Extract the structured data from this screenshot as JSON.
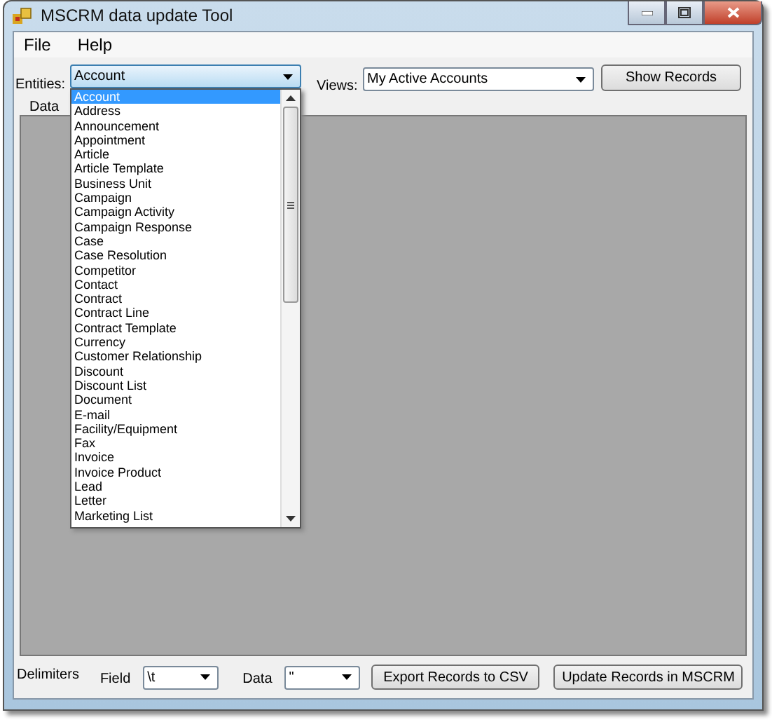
{
  "window": {
    "title": "MSCRM data update Tool"
  },
  "menu": [
    "File",
    "Help"
  ],
  "entities": {
    "label": "Entities:",
    "value": "Account",
    "expanded": true,
    "options": [
      {
        "label": "Account",
        "selected": true
      },
      {
        "label": "Address",
        "selected": false
      },
      {
        "label": "Announcement",
        "selected": false
      },
      {
        "label": "Appointment",
        "selected": false
      },
      {
        "label": "Article",
        "selected": false
      },
      {
        "label": "Article Template",
        "selected": false
      },
      {
        "label": "Business Unit",
        "selected": false
      },
      {
        "label": "Campaign",
        "selected": false
      },
      {
        "label": "Campaign Activity",
        "selected": false
      },
      {
        "label": "Campaign Response",
        "selected": false
      },
      {
        "label": "Case",
        "selected": false
      },
      {
        "label": "Case Resolution",
        "selected": false
      },
      {
        "label": "Competitor",
        "selected": false
      },
      {
        "label": "Contact",
        "selected": false
      },
      {
        "label": "Contract",
        "selected": false
      },
      {
        "label": "Contract Line",
        "selected": false
      },
      {
        "label": "Contract Template",
        "selected": false
      },
      {
        "label": "Currency",
        "selected": false
      },
      {
        "label": "Customer Relationship",
        "selected": false
      },
      {
        "label": "Discount",
        "selected": false
      },
      {
        "label": "Discount List",
        "selected": false
      },
      {
        "label": "Document",
        "selected": false
      },
      {
        "label": "E-mail",
        "selected": false
      },
      {
        "label": "Facility/Equipment",
        "selected": false
      },
      {
        "label": "Fax",
        "selected": false
      },
      {
        "label": "Invoice",
        "selected": false
      },
      {
        "label": "Invoice Product",
        "selected": false
      },
      {
        "label": "Lead",
        "selected": false
      },
      {
        "label": "Letter",
        "selected": false
      },
      {
        "label": "Marketing List",
        "selected": false
      }
    ]
  },
  "views": {
    "label": "Views:",
    "value": "My Active Accounts"
  },
  "show_button": "Show Records",
  "data_group": {
    "title": "Data"
  },
  "delimiters": {
    "label": "Delimiters",
    "field_label": "Field",
    "field_value": "\\t",
    "data_label": "Data",
    "data_value": "\""
  },
  "buttons": [
    "Export Records to CSV",
    "Update Records in MSCRM"
  ]
}
